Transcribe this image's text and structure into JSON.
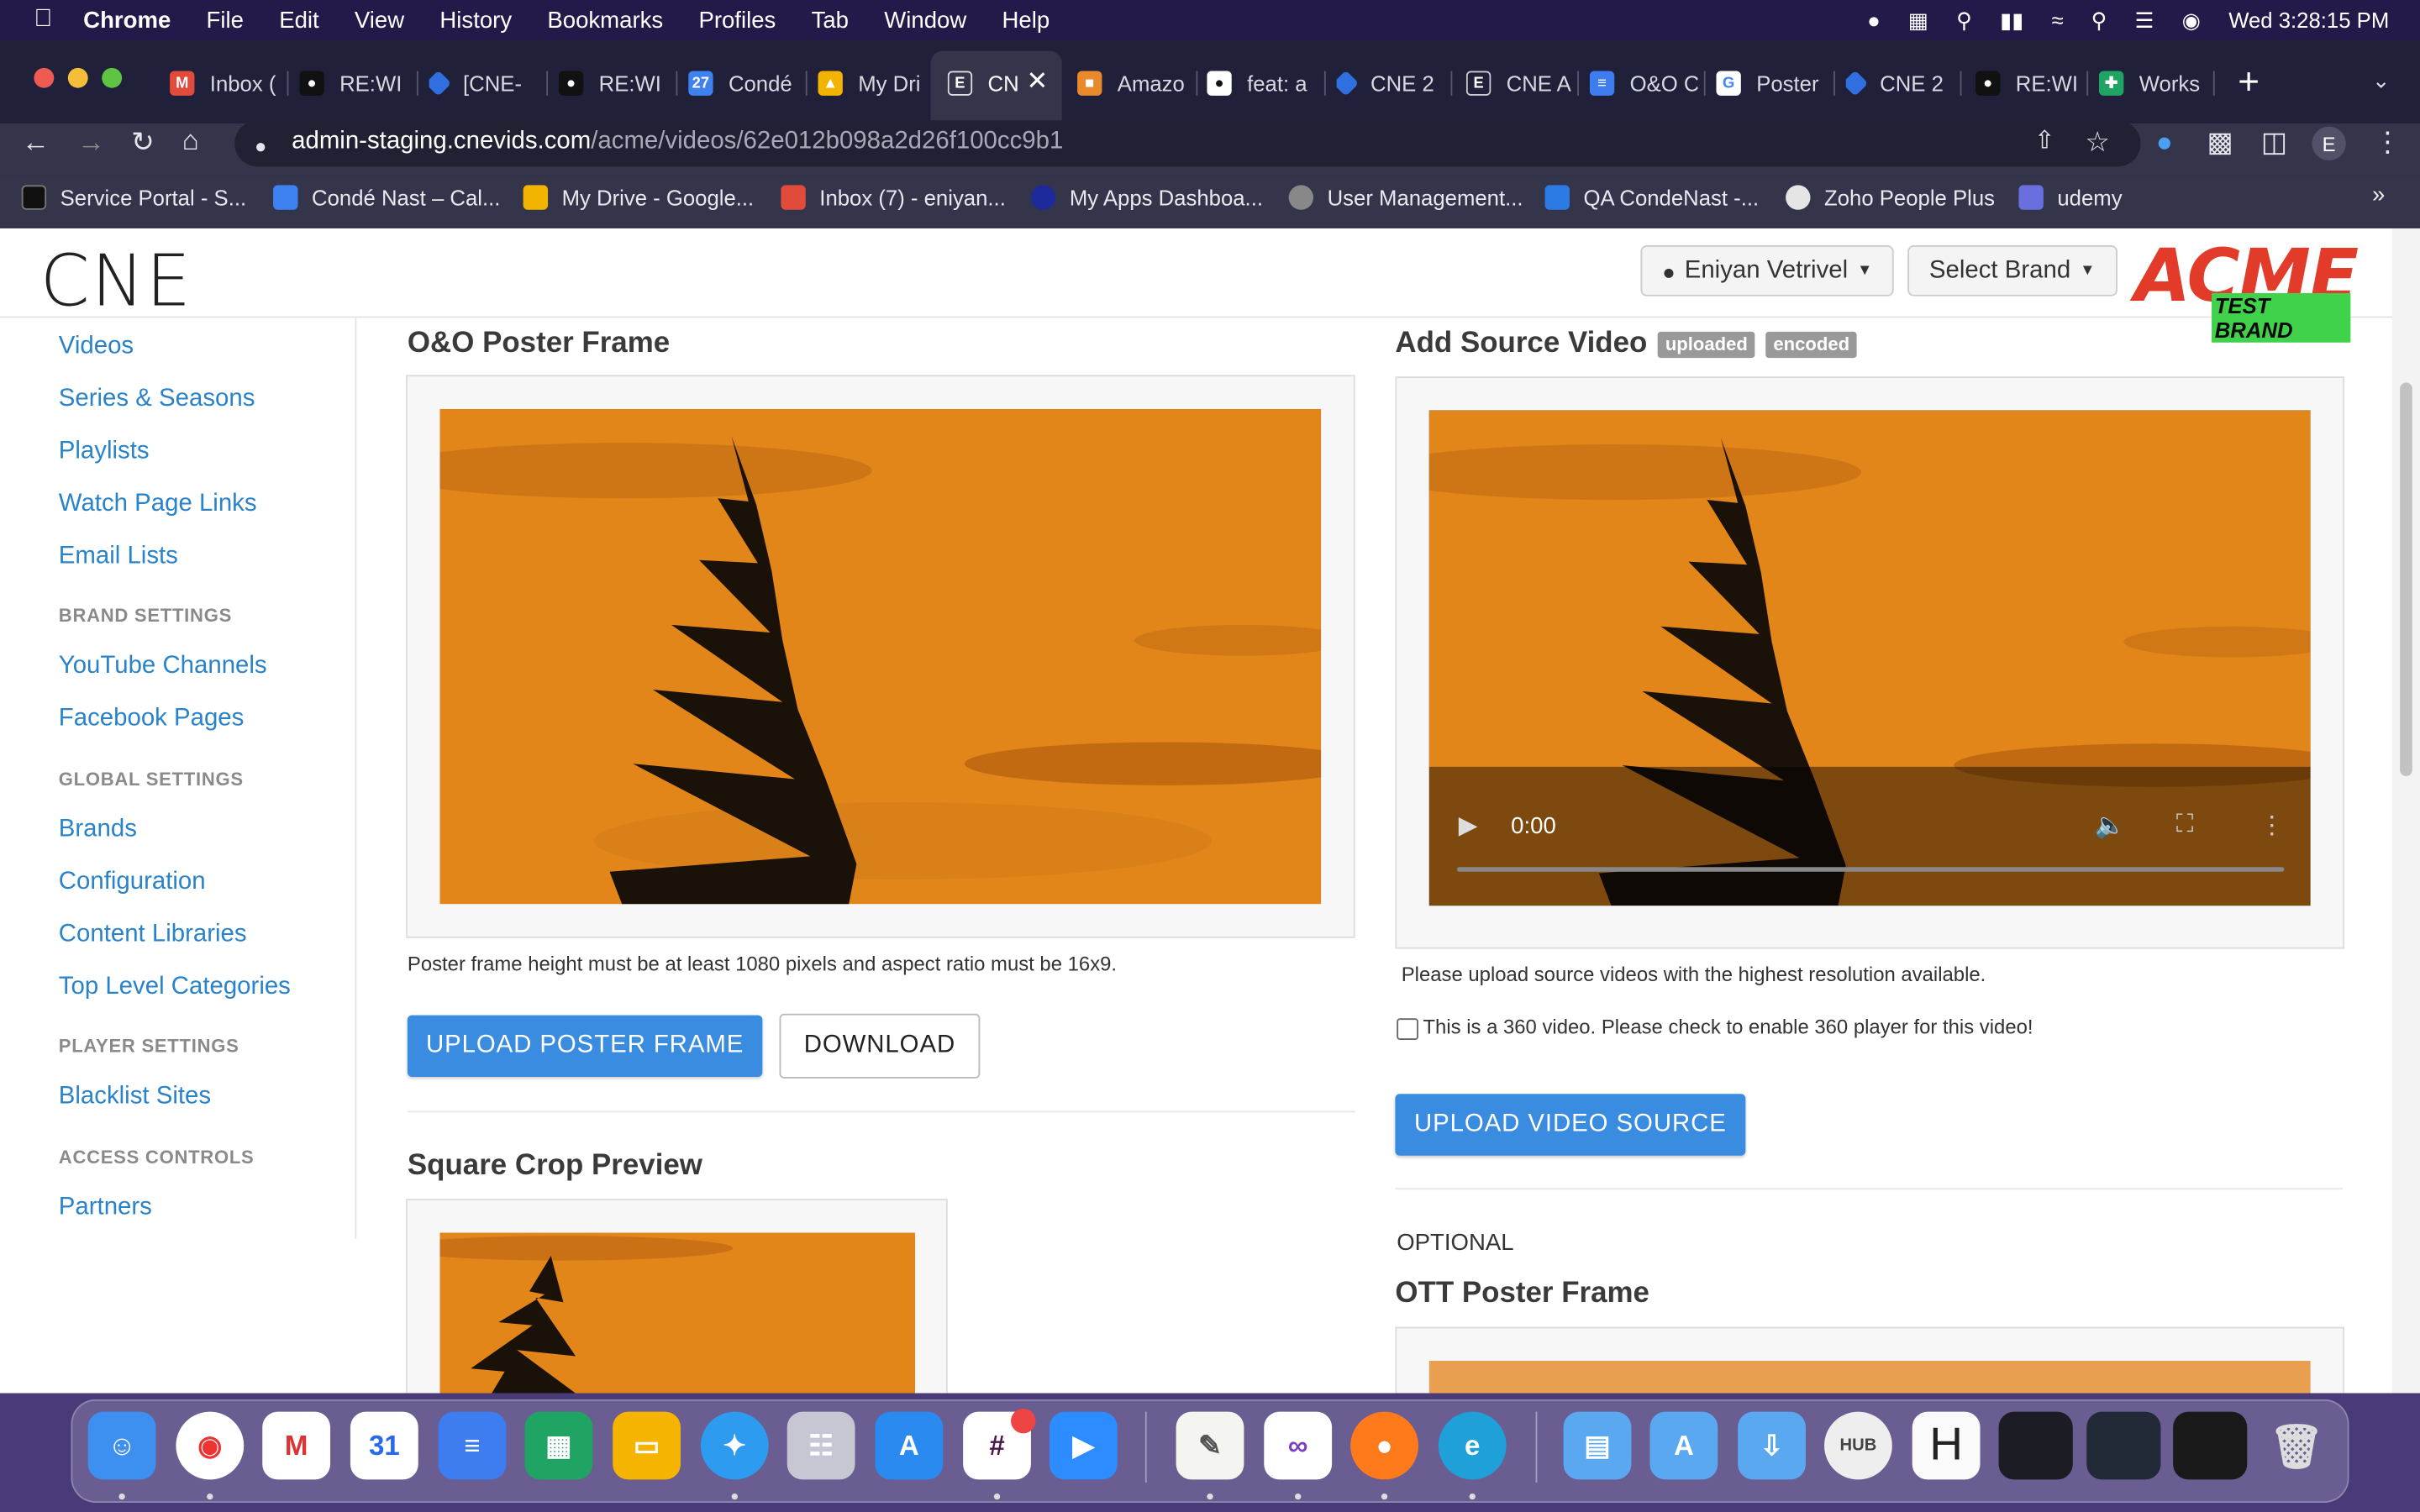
{
  "menubar": {
    "app": "Chrome",
    "items": [
      "File",
      "Edit",
      "View",
      "History",
      "Bookmarks",
      "Profiles",
      "Tab",
      "Window",
      "Help"
    ],
    "clock": "Wed 3:28:15 PM"
  },
  "tabs": [
    {
      "label": "Inbox (",
      "icon": "gmail-icon"
    },
    {
      "label": "RE:WI",
      "icon": "github-icon"
    },
    {
      "label": "[CNE-",
      "icon": "jira-icon"
    },
    {
      "label": "RE:WI",
      "icon": "github-icon"
    },
    {
      "label": "Condé",
      "icon": "calendar-icon"
    },
    {
      "label": "My Dri",
      "icon": "drive-icon"
    },
    {
      "label": "CN",
      "icon": "cne-icon"
    },
    {
      "label": "Amazo",
      "icon": "aws-icon"
    },
    {
      "label": "feat: a",
      "icon": "github-icon"
    },
    {
      "label": "CNE 2",
      "icon": "jira-icon"
    },
    {
      "label": "CNE A",
      "icon": "cne-icon"
    },
    {
      "label": "O&O C",
      "icon": "docs-icon"
    },
    {
      "label": "Poster",
      "icon": "google-icon"
    },
    {
      "label": "CNE 2",
      "icon": "jira-icon"
    },
    {
      "label": "RE:WI",
      "icon": "github-icon"
    },
    {
      "label": "Works",
      "icon": "sheets-icon"
    }
  ],
  "url": {
    "host": "admin-staging.cnevids.com",
    "path": "/acme/videos/62e012b098a2d26f100cc9b1"
  },
  "profile_initial": "E",
  "bookmarks": [
    "Service Portal - S...",
    "Condé Nast – Cal...",
    "My Drive - Google...",
    "Inbox (7) - eniyan...",
    "My Apps Dashboa...",
    "User Management...",
    "QA CondeNast -...",
    "Zoho People Plus",
    "udemy"
  ],
  "header": {
    "logo": "CNE",
    "user": "Eniyan Vetrivel",
    "brand_select": "Select Brand",
    "brand_logo_main": "ACME",
    "brand_logo_sub": "TEST BRAND"
  },
  "sidebar": {
    "top_links": [
      "Videos",
      "Series & Seasons",
      "Playlists",
      "Watch Page Links",
      "Email Lists"
    ],
    "brand_settings": {
      "heading": "BRAND SETTINGS",
      "links": [
        "YouTube Channels",
        "Facebook Pages"
      ]
    },
    "global_settings": {
      "heading": "GLOBAL SETTINGS",
      "links": [
        "Brands",
        "Configuration",
        "Content Libraries",
        "Top Level Categories"
      ]
    },
    "player_settings": {
      "heading": "PLAYER SETTINGS",
      "links": [
        "Blacklist Sites"
      ]
    },
    "access_controls": {
      "heading": "ACCESS CONTROLS",
      "links": [
        "Partners"
      ]
    }
  },
  "poster": {
    "title": "O&O Poster Frame",
    "note": "Poster frame height must be at least 1080 pixels and aspect ratio must be 16x9.",
    "upload_label": "UPLOAD POSTER FRAME",
    "download_label": "DOWNLOAD"
  },
  "square": {
    "title": "Square Crop Preview"
  },
  "source": {
    "title": "Add Source Video",
    "badges": [
      "uploaded",
      "encoded"
    ],
    "time": "0:00",
    "note": "Please upload source videos with the highest resolution available.",
    "checkbox_label": "This is a 360 video. Please check to enable 360 player for this video!",
    "checkbox_checked": false,
    "upload_label": "UPLOAD VIDEO SOURCE"
  },
  "optional": {
    "label": "OPTIONAL",
    "title": "OTT Poster Frame"
  },
  "dock_apps": [
    "finder-icon",
    "chrome-icon",
    "gmail-icon",
    "calendar-icon",
    "docs-icon",
    "sheets-icon",
    "slides-icon",
    "safari-icon",
    "launchpad-icon",
    "appstore-icon",
    "slack-icon",
    "zoom-icon",
    "textedit-icon",
    "visualstudio-icon",
    "firefox-icon",
    "edge-icon",
    "folder-icon",
    "appfolder-icon",
    "downloads-icon",
    "hub-icon",
    "h-icon",
    "window1-icon",
    "window2-icon",
    "window3-icon",
    "trash-icon"
  ],
  "dock_calendar_day": "31",
  "dock_hub_label": "HUB",
  "dock_h_label": "H",
  "colors": {
    "link": "#2a83c9",
    "primary_button": "#3a8ce0",
    "badge": "#999999",
    "acme_red": "#e23b2a",
    "sky": "#e3861a"
  }
}
